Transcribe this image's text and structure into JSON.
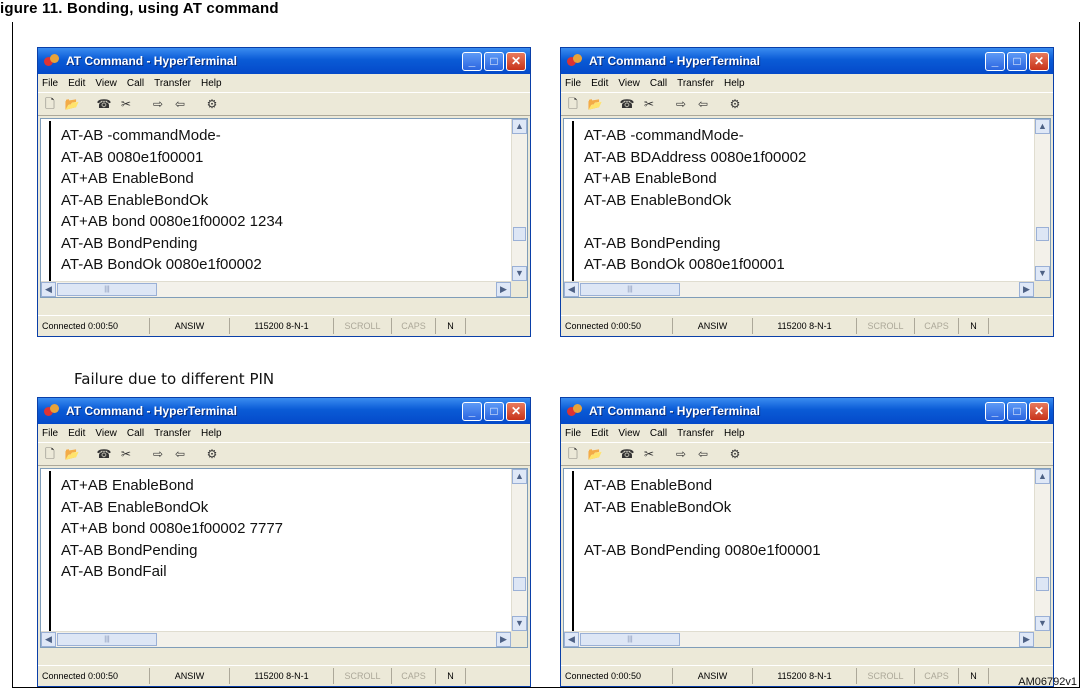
{
  "figure": {
    "caption": "igure 11. Bonding, using AT command",
    "failure_note": "Failure due to different PIN",
    "code": "AM06792v1"
  },
  "window": {
    "title": "AT Command - HyperTerminal",
    "menus": [
      "File",
      "Edit",
      "View",
      "Call",
      "Transfer",
      "Help"
    ],
    "toolbar_icons": [
      "new-file-icon",
      "open-folder-icon",
      "call-icon",
      "disconnect-icon",
      "send-icon",
      "receive-icon",
      "properties-icon"
    ],
    "status": {
      "connected": "Connected 0:00:50",
      "emulation": "ANSIW",
      "port": "115200 8-N-1",
      "scroll": "SCROLL",
      "caps": "CAPS",
      "num": "N"
    }
  },
  "terminals": [
    {
      "lines": [
        "AT-AB -commandMode-",
        "AT-AB 0080e1f00001",
        "AT+AB EnableBond",
        "AT-AB EnableBondOk",
        "AT+AB bond 0080e1f00002 1234",
        "AT-AB BondPending",
        "AT-AB BondOk 0080e1f00002"
      ]
    },
    {
      "lines": [
        "AT-AB -commandMode-",
        "AT-AB BDAddress 0080e1f00002",
        "AT+AB EnableBond",
        "AT-AB EnableBondOk",
        "",
        "AT-AB BondPending",
        "AT-AB BondOk 0080e1f00001"
      ]
    },
    {
      "lines": [
        "AT+AB EnableBond",
        "AT-AB EnableBondOk",
        "AT+AB bond 0080e1f00002 7777",
        "AT-AB BondPending",
        "AT-AB BondFail"
      ]
    },
    {
      "lines": [
        "AT-AB EnableBond",
        "AT-AB EnableBondOk",
        "",
        "AT-AB  BondPending 0080e1f00001"
      ]
    }
  ]
}
